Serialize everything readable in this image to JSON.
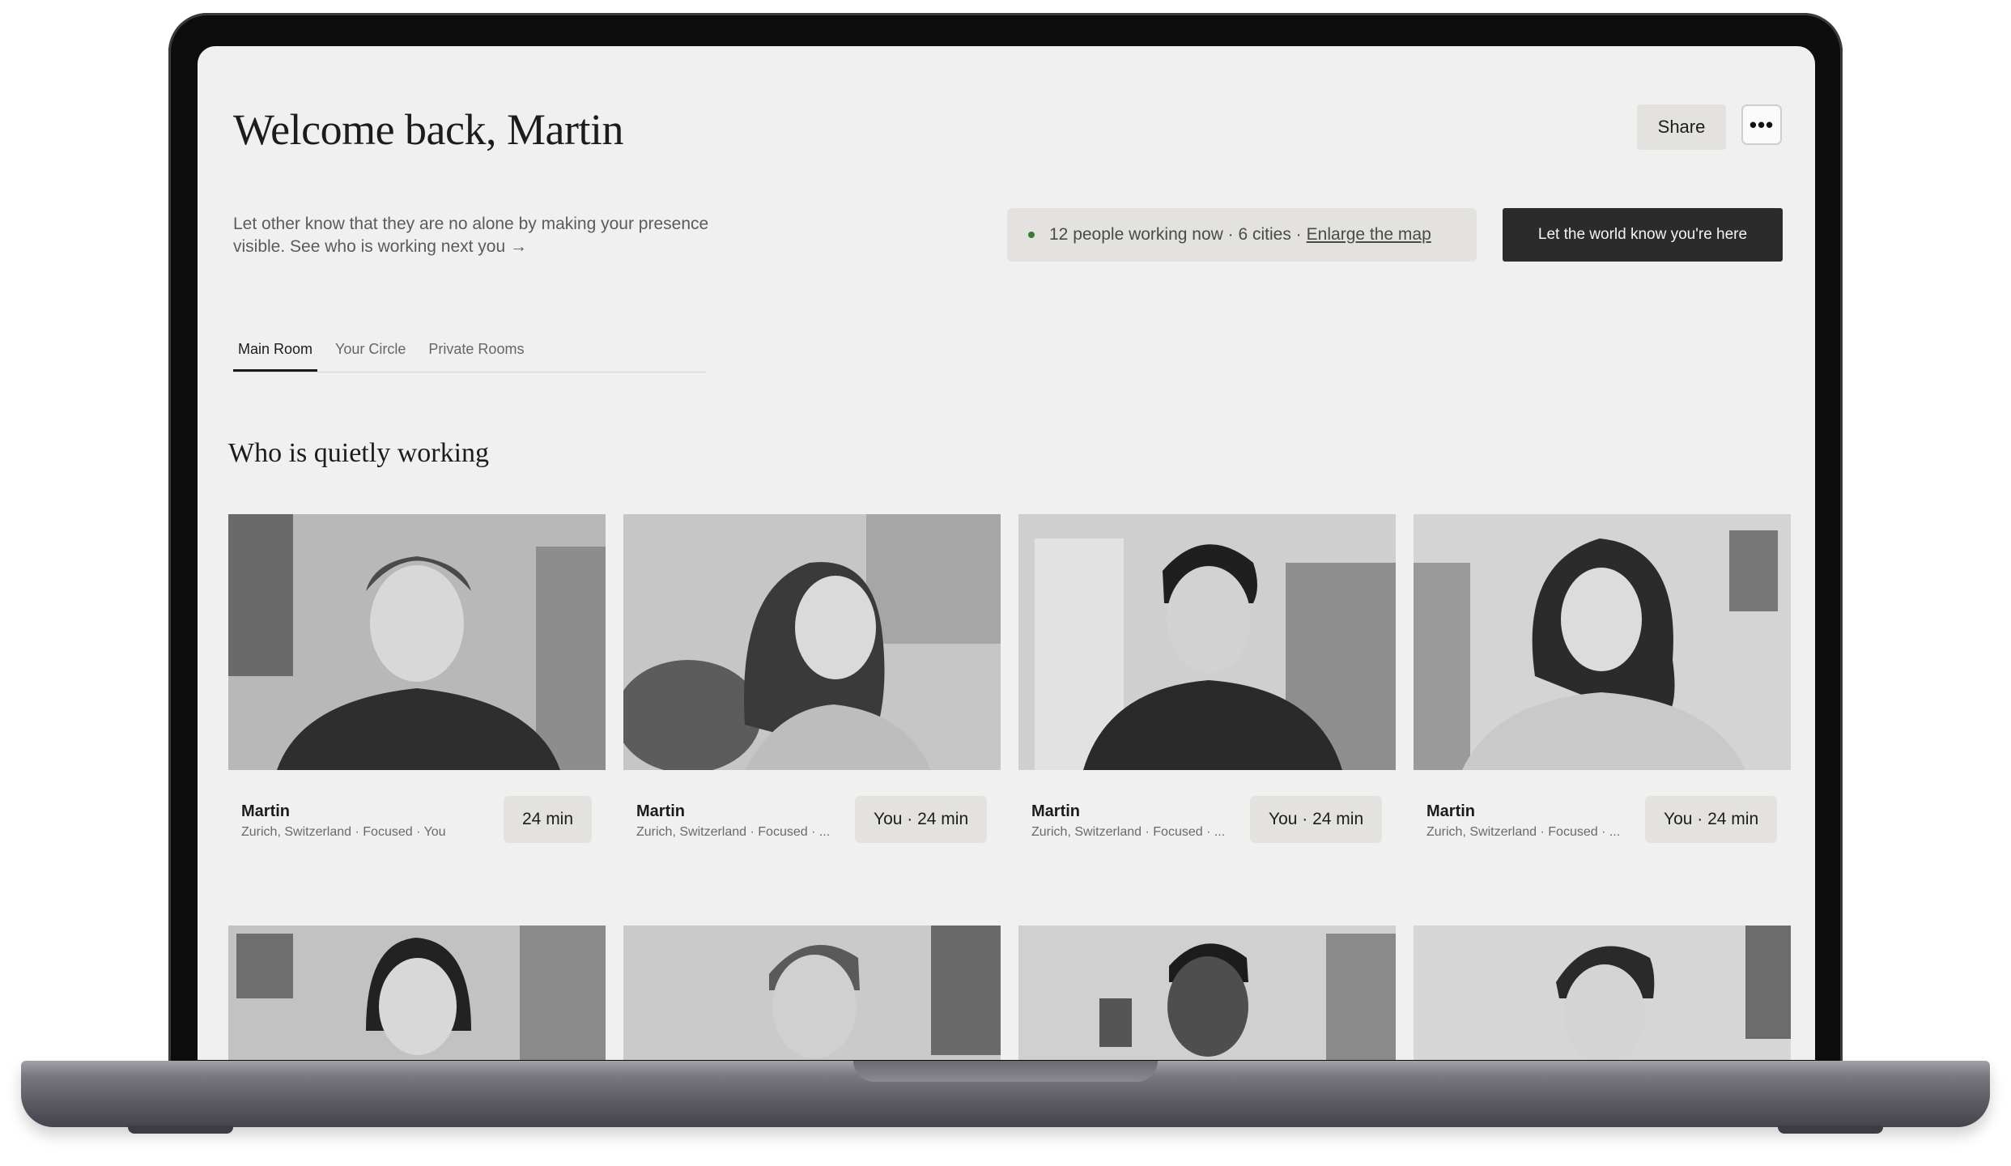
{
  "header": {
    "title": "Welcome back, Martin",
    "share_label": "Share",
    "more_label": "•••"
  },
  "intro": {
    "text": "Let other know that they are no alone by making your presence visible. See who is working next you →"
  },
  "status": {
    "summary": "12 people working now · 6 cities ·",
    "map_link": "Enlarge the map"
  },
  "cta_label": "Let the world know you're here",
  "tabs": [
    {
      "label": "Main Room",
      "active": true
    },
    {
      "label": "Your Circle",
      "active": false
    },
    {
      "label": "Private Rooms",
      "active": false
    }
  ],
  "section_title": "Who is quietly working",
  "cards": [
    {
      "name": "Martin",
      "meta": "Zurich, Switzerland · Focused · You",
      "time": "24 min"
    },
    {
      "name": "Martin",
      "meta": "Zurich, Switzerland · Focused · ...",
      "time": "You · 24 min"
    },
    {
      "name": "Martin",
      "meta": "Zurich, Switzerland · Focused · ...",
      "time": "You · 24 min"
    },
    {
      "name": "Martin",
      "meta": "Zurich, Switzerland · Focused · ...",
      "time": "You · 24 min"
    }
  ],
  "colors": {
    "screen_bg": "#f0f0f0",
    "cta_bg": "#2b2b2b",
    "chip_bg": "#e3e2de",
    "status_dot": "#3b7a3b"
  }
}
